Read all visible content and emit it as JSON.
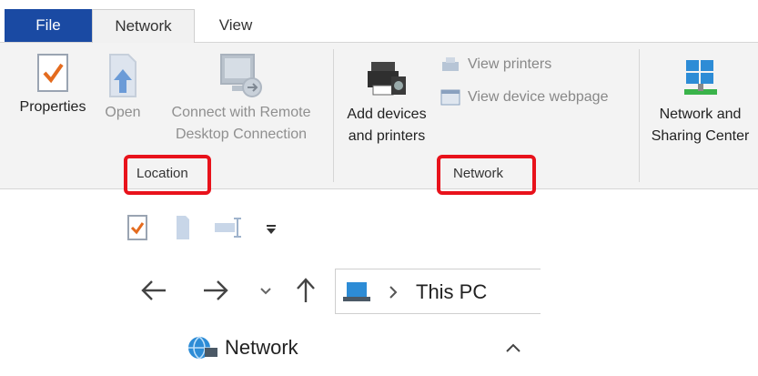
{
  "tabs": {
    "file": "File",
    "network": "Network",
    "view": "View"
  },
  "ribbon": {
    "location_group": {
      "label": "Location",
      "properties": "Properties",
      "open": "Open",
      "connect_line1": "Connect with Remote",
      "connect_line2": "Desktop Connection"
    },
    "network_group": {
      "label": "Network",
      "add_devices_line1": "Add devices",
      "add_devices_line2": "and printers",
      "view_printers": "View printers",
      "view_device_webpage": "View device webpage"
    },
    "sharing": {
      "line1": "Network and",
      "line2": "Sharing Center"
    }
  },
  "address": {
    "breadcrumb": "This PC"
  },
  "navpane": {
    "network_item": "Network"
  },
  "colors": {
    "file_tab": "#1a4aa3",
    "highlight": "#e8121b"
  }
}
